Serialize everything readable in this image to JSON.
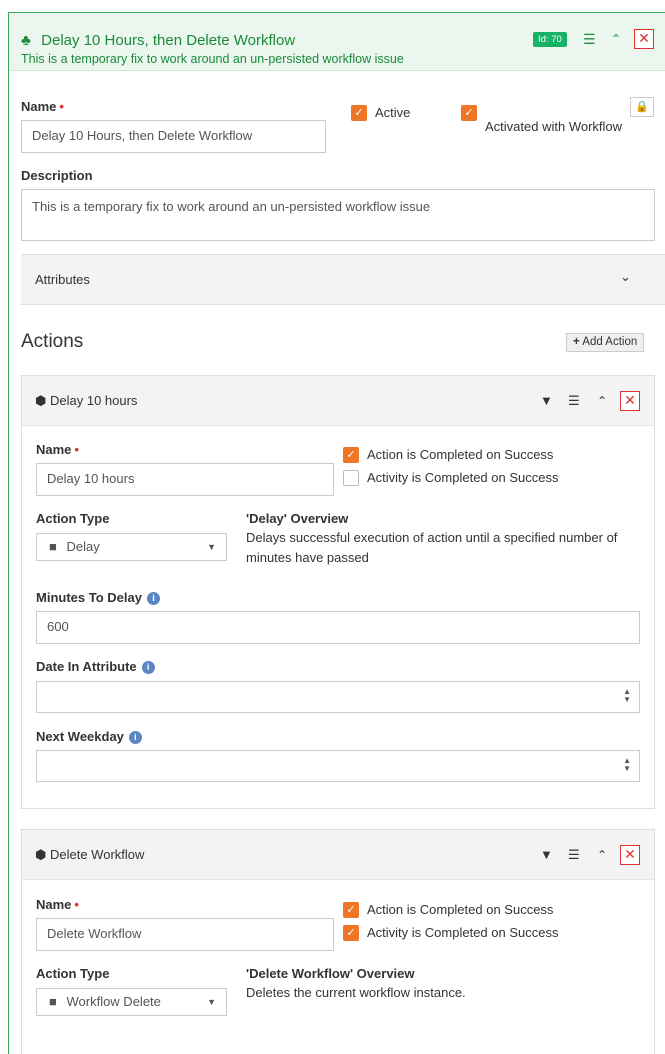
{
  "activity": {
    "title": "Delay 10 Hours, then Delete Workflow",
    "description": "This is a temporary fix to work around an un-persisted workflow issue",
    "id_badge": "Id: 70",
    "name_label": "Name",
    "name_value": "Delay 10 Hours, then Delete Workflow",
    "active_label": "Active",
    "activated_label": "Activated with Workflow",
    "description_label": "Description",
    "description_value": "This is a temporary fix to work around an un-persisted workflow issue",
    "attributes_label": "Attributes"
  },
  "actions_section": {
    "title": "Actions",
    "add_button": "Add Action"
  },
  "actions": [
    {
      "title": "Delay 10 hours",
      "name_label": "Name",
      "name_value": "Delay 10 hours",
      "completed_success_label": "Action is Completed on Success",
      "activity_success_label": "Activity is Completed on Success",
      "action_type_label": "Action Type",
      "action_type_value": "Delay",
      "overview_title": "'Delay' Overview",
      "overview_text": "Delays successful execution of action until a specified number of minutes have passed",
      "minutes_label": "Minutes To Delay",
      "minutes_value": "600",
      "date_attr_label": "Date In Attribute",
      "next_weekday_label": "Next Weekday"
    },
    {
      "title": "Delete Workflow",
      "name_label": "Name",
      "name_value": "Delete Workflow",
      "completed_success_label": "Action is Completed on Success",
      "activity_success_label": "Activity is Completed on Success",
      "action_type_label": "Action Type",
      "action_type_value": "Workflow Delete",
      "overview_title": "'Delete Workflow' Overview",
      "overview_text": "Deletes the current workflow instance."
    }
  ],
  "colors": {
    "accent_green": "#1b8a3a",
    "checkbox_orange": "#ee7624",
    "danger_red": "#d33",
    "badge_green": "#16b364"
  }
}
